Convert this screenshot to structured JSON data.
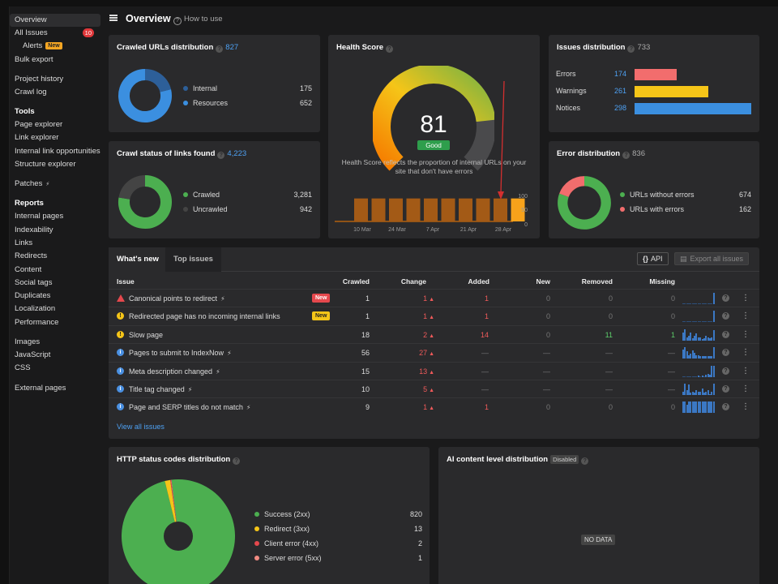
{
  "sidebar": {
    "items": [
      {
        "label": "Overview",
        "active": true
      },
      {
        "label": "All Issues",
        "badge": "10"
      },
      {
        "label": "Alerts",
        "new": "New",
        "indent": true
      },
      {
        "label": "Bulk export"
      },
      {
        "label": "Project history"
      },
      {
        "label": "Crawl log"
      },
      {
        "label": "Tools",
        "head": true
      },
      {
        "label": "Page explorer"
      },
      {
        "label": "Link explorer"
      },
      {
        "label": "Internal link opportunities"
      },
      {
        "label": "Structure explorer"
      },
      {
        "label": "Patches"
      },
      {
        "label": "Reports",
        "head": true
      },
      {
        "label": "Internal pages"
      },
      {
        "label": "Indexability"
      },
      {
        "label": "Links"
      },
      {
        "label": "Redirects"
      },
      {
        "label": "Content"
      },
      {
        "label": "Social tags"
      },
      {
        "label": "Duplicates"
      },
      {
        "label": "Localization"
      },
      {
        "label": "Performance"
      },
      {
        "label": "Images"
      },
      {
        "label": "JavaScript"
      },
      {
        "label": "CSS"
      },
      {
        "label": "External pages"
      }
    ]
  },
  "header": {
    "title": "Overview",
    "how_to": "How to use"
  },
  "crawled": {
    "title": "Crawled URLs distribution",
    "count": "827",
    "legend": [
      {
        "label": "Internal",
        "value": "175",
        "color": "#2d5f99"
      },
      {
        "label": "Resources",
        "value": "652",
        "color": "#3b8fe0"
      }
    ]
  },
  "crawl_status": {
    "title": "Crawl status of links found",
    "count": "4,223",
    "legend": [
      {
        "label": "Crawled",
        "value": "3,281",
        "color": "#4caf50"
      },
      {
        "label": "Uncrawled",
        "value": "942",
        "color": "#444"
      }
    ]
  },
  "health": {
    "title": "Health Score",
    "score": "81",
    "status": "Good",
    "description_1": "Health Score reflects the proportion of internal URLs on your",
    "description_2": "site that don't have errors",
    "y_ticks": [
      "100",
      "50",
      "0"
    ],
    "x_ticks": [
      "10 Mar",
      "24 Mar",
      "7 Apr",
      "21 Apr",
      "28 Apr"
    ],
    "bars": [
      81,
      81,
      81,
      81,
      81,
      81,
      81,
      81,
      81,
      81
    ]
  },
  "issues_dist": {
    "title": "Issues distribution",
    "count": "733",
    "rows": [
      {
        "label": "Errors",
        "value": "174",
        "frac": 0.36,
        "color": "#f26d6d"
      },
      {
        "label": "Warnings",
        "value": "261",
        "frac": 0.63,
        "color": "#f5c518"
      },
      {
        "label": "Notices",
        "value": "298",
        "frac": 1.0,
        "color": "#3b8fe0"
      }
    ]
  },
  "error_dist": {
    "title": "Error distribution",
    "count": "836",
    "legend": [
      {
        "label": "URLs without errors",
        "value": "674",
        "color": "#4caf50"
      },
      {
        "label": "URLs with errors",
        "value": "162",
        "color": "#f26d6d"
      }
    ]
  },
  "issues_table": {
    "tabs": [
      "What's new",
      "Top issues"
    ],
    "api": "API",
    "export": "Export all issues",
    "headers": [
      "Issue",
      "Crawled",
      "Change",
      "Added",
      "New",
      "Removed",
      "Missing"
    ],
    "rows": [
      {
        "sev": "err",
        "name": "Canonical points to redirect",
        "bolt": true,
        "tag": "New",
        "tag_color": "#e5484d",
        "crawled": "1",
        "change": "1",
        "added": "1",
        "new": "0",
        "removed": "0",
        "missing": "0",
        "spark": [
          0,
          0,
          0,
          0,
          0,
          0,
          0,
          0,
          0,
          0,
          0,
          0,
          0,
          0,
          0,
          0,
          12
        ]
      },
      {
        "sev": "warn",
        "name": "Redirected page has no incoming internal links",
        "bolt": false,
        "tag": "New",
        "tag_color": "#f5c518",
        "crawled": "1",
        "change": "1",
        "added": "1",
        "new": "0",
        "removed": "0",
        "missing": "0",
        "spark": [
          0,
          0,
          0,
          0,
          0,
          0,
          0,
          0,
          0,
          0,
          0,
          0,
          0,
          0,
          0,
          0,
          12
        ]
      },
      {
        "sev": "warn",
        "name": "Slow page",
        "bolt": false,
        "tag": "",
        "crawled": "18",
        "change": "2",
        "added": "14",
        "new": "0",
        "removed": "11",
        "missing": "1",
        "spark": [
          9,
          13,
          4,
          5,
          9,
          3,
          5,
          8,
          4,
          4,
          2,
          3,
          5,
          4,
          3,
          4,
          12
        ]
      },
      {
        "sev": "note",
        "name": "Pages to submit to IndexNow",
        "bolt": true,
        "tag": "",
        "crawled": "56",
        "change": "27",
        "added": "—",
        "new": "—",
        "removed": "—",
        "missing": "—",
        "spark": [
          10,
          12,
          8,
          4,
          5,
          9,
          6,
          4,
          4,
          3,
          3,
          3,
          3,
          3,
          3,
          3,
          12
        ]
      },
      {
        "sev": "note",
        "name": "Meta description changed",
        "bolt": true,
        "tag": "",
        "crawled": "15",
        "change": "13",
        "added": "—",
        "new": "—",
        "removed": "—",
        "missing": "—",
        "spark": [
          0,
          0,
          0,
          0,
          0,
          0,
          0,
          0,
          1,
          0,
          1,
          0,
          2,
          3,
          2,
          12,
          12
        ]
      },
      {
        "sev": "note",
        "name": "Title tag changed",
        "bolt": true,
        "tag": "",
        "crawled": "10",
        "change": "5",
        "added": "—",
        "new": "—",
        "removed": "—",
        "missing": "—",
        "spark": [
          3,
          10,
          4,
          9,
          2,
          3,
          2,
          4,
          3,
          3,
          6,
          2,
          3,
          4,
          1,
          3,
          10
        ]
      },
      {
        "sev": "note",
        "name": "Page and SERP titles do not match",
        "bolt": true,
        "tag": "",
        "crawled": "9",
        "change": "1",
        "added": "1",
        "new": "0",
        "removed": "0",
        "missing": "0",
        "spark": [
          12,
          12,
          9,
          12,
          12,
          12,
          12,
          12,
          12,
          12,
          12,
          12,
          12,
          12,
          12,
          12,
          12
        ]
      }
    ],
    "view_all": "View all issues"
  },
  "http": {
    "title": "HTTP status codes distribution",
    "legend": [
      {
        "label": "Success (2xx)",
        "value": "820",
        "color": "#4caf50"
      },
      {
        "label": "Redirect (3xx)",
        "value": "13",
        "color": "#f5c518"
      },
      {
        "label": "Client error (4xx)",
        "value": "2",
        "color": "#e5484d"
      },
      {
        "label": "Server error (5xx)",
        "value": "1",
        "color": "#f28b82"
      }
    ]
  },
  "ai": {
    "title": "AI content level distribution",
    "tag": "Disabled",
    "nodata": "NO DATA"
  }
}
